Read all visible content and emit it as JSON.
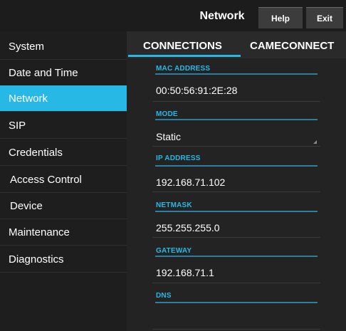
{
  "header": {
    "title": "Network",
    "help_label": "Help",
    "exit_label": "Exit"
  },
  "sidebar": {
    "items": [
      {
        "label": "System"
      },
      {
        "label": "Date and Time"
      },
      {
        "label": "Network",
        "active": true
      },
      {
        "label": "SIP"
      },
      {
        "label": "Credentials"
      },
      {
        "label": "Access Control"
      },
      {
        "label": "Device"
      },
      {
        "label": "Maintenance"
      },
      {
        "label": "Diagnostics"
      }
    ]
  },
  "tabs": [
    {
      "label": "CONNECTIONS",
      "active": true
    },
    {
      "label": "CAMECONNECT",
      "active": false
    }
  ],
  "fields": {
    "mac": {
      "label": "MAC ADDRESS",
      "value": "00:50:56:91:2E:28"
    },
    "mode": {
      "label": "MODE",
      "value": "Static"
    },
    "ip": {
      "label": "IP ADDRESS",
      "value": "192.168.71.102"
    },
    "netmask": {
      "label": "NETMASK",
      "value": "255.255.255.0"
    },
    "gateway": {
      "label": "GATEWAY",
      "value": "192.168.71.1"
    },
    "dns": {
      "label": "DNS",
      "value": ""
    }
  },
  "colors": {
    "accent": "#28b8e6",
    "background": "#202020"
  }
}
